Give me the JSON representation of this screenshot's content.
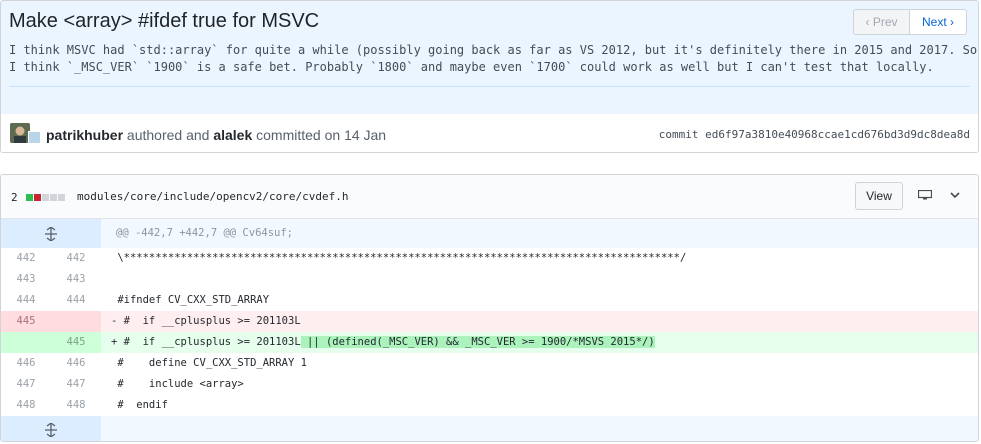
{
  "commit": {
    "title": "Make <array> #ifdef true for MSVC",
    "description_line1": "I think MSVC had `std::array` for quite a while (possibly going back as far as VS 2012, but it's definitely there in 2015 and 2017. So",
    "description_line2": "I think `_MSC_VER` `1900` is a safe bet. Probably `1800` and maybe even `1700` could work as well but I can't test that locally.",
    "prev_label": "‹ Prev",
    "next_label": "Next ›",
    "author": "patrikhuber",
    "authored_text": " authored and ",
    "committer": "alalek",
    "committed_text": " committed on 14 Jan",
    "sha_label": "commit ed6f97a3810e40968ccae1cd676bd3d9dc8dea8d"
  },
  "file": {
    "changes": "2",
    "path": "modules/core/include/opencv2/core/cvdef.h",
    "view_label": "View",
    "stat_colors": [
      "#2cbe4e",
      "#cb2431",
      "#d1d5da",
      "#d1d5da",
      "#d1d5da"
    ]
  },
  "diff": {
    "expand_icon": "expand-icon",
    "hunk_header": "@@ -442,7 +442,7 @@ Cv64suf;",
    "rows": [
      {
        "type": "ctx",
        "old": "442",
        "new": "442",
        "code": " \\****************************************************************************************/"
      },
      {
        "type": "ctx",
        "old": "443",
        "new": "443",
        "code": ""
      },
      {
        "type": "ctx",
        "old": "444",
        "new": "444",
        "code": " #ifndef CV_CXX_STD_ARRAY"
      },
      {
        "type": "del",
        "old": "445",
        "new": "",
        "code": "- #  if __cplusplus >= 201103L"
      },
      {
        "type": "add",
        "old": "",
        "new": "445",
        "code": "+ #  if __cplusplus >= 201103L",
        "added": " || (defined(_MSC_VER) && _MSC_VER >= 1900/*MSVS 2015*/)"
      },
      {
        "type": "ctx",
        "old": "446",
        "new": "446",
        "code": " #    define CV_CXX_STD_ARRAY 1"
      },
      {
        "type": "ctx",
        "old": "447",
        "new": "447",
        "code": " #    include <array>"
      },
      {
        "type": "ctx",
        "old": "448",
        "new": "448",
        "code": " #  endif"
      }
    ]
  }
}
